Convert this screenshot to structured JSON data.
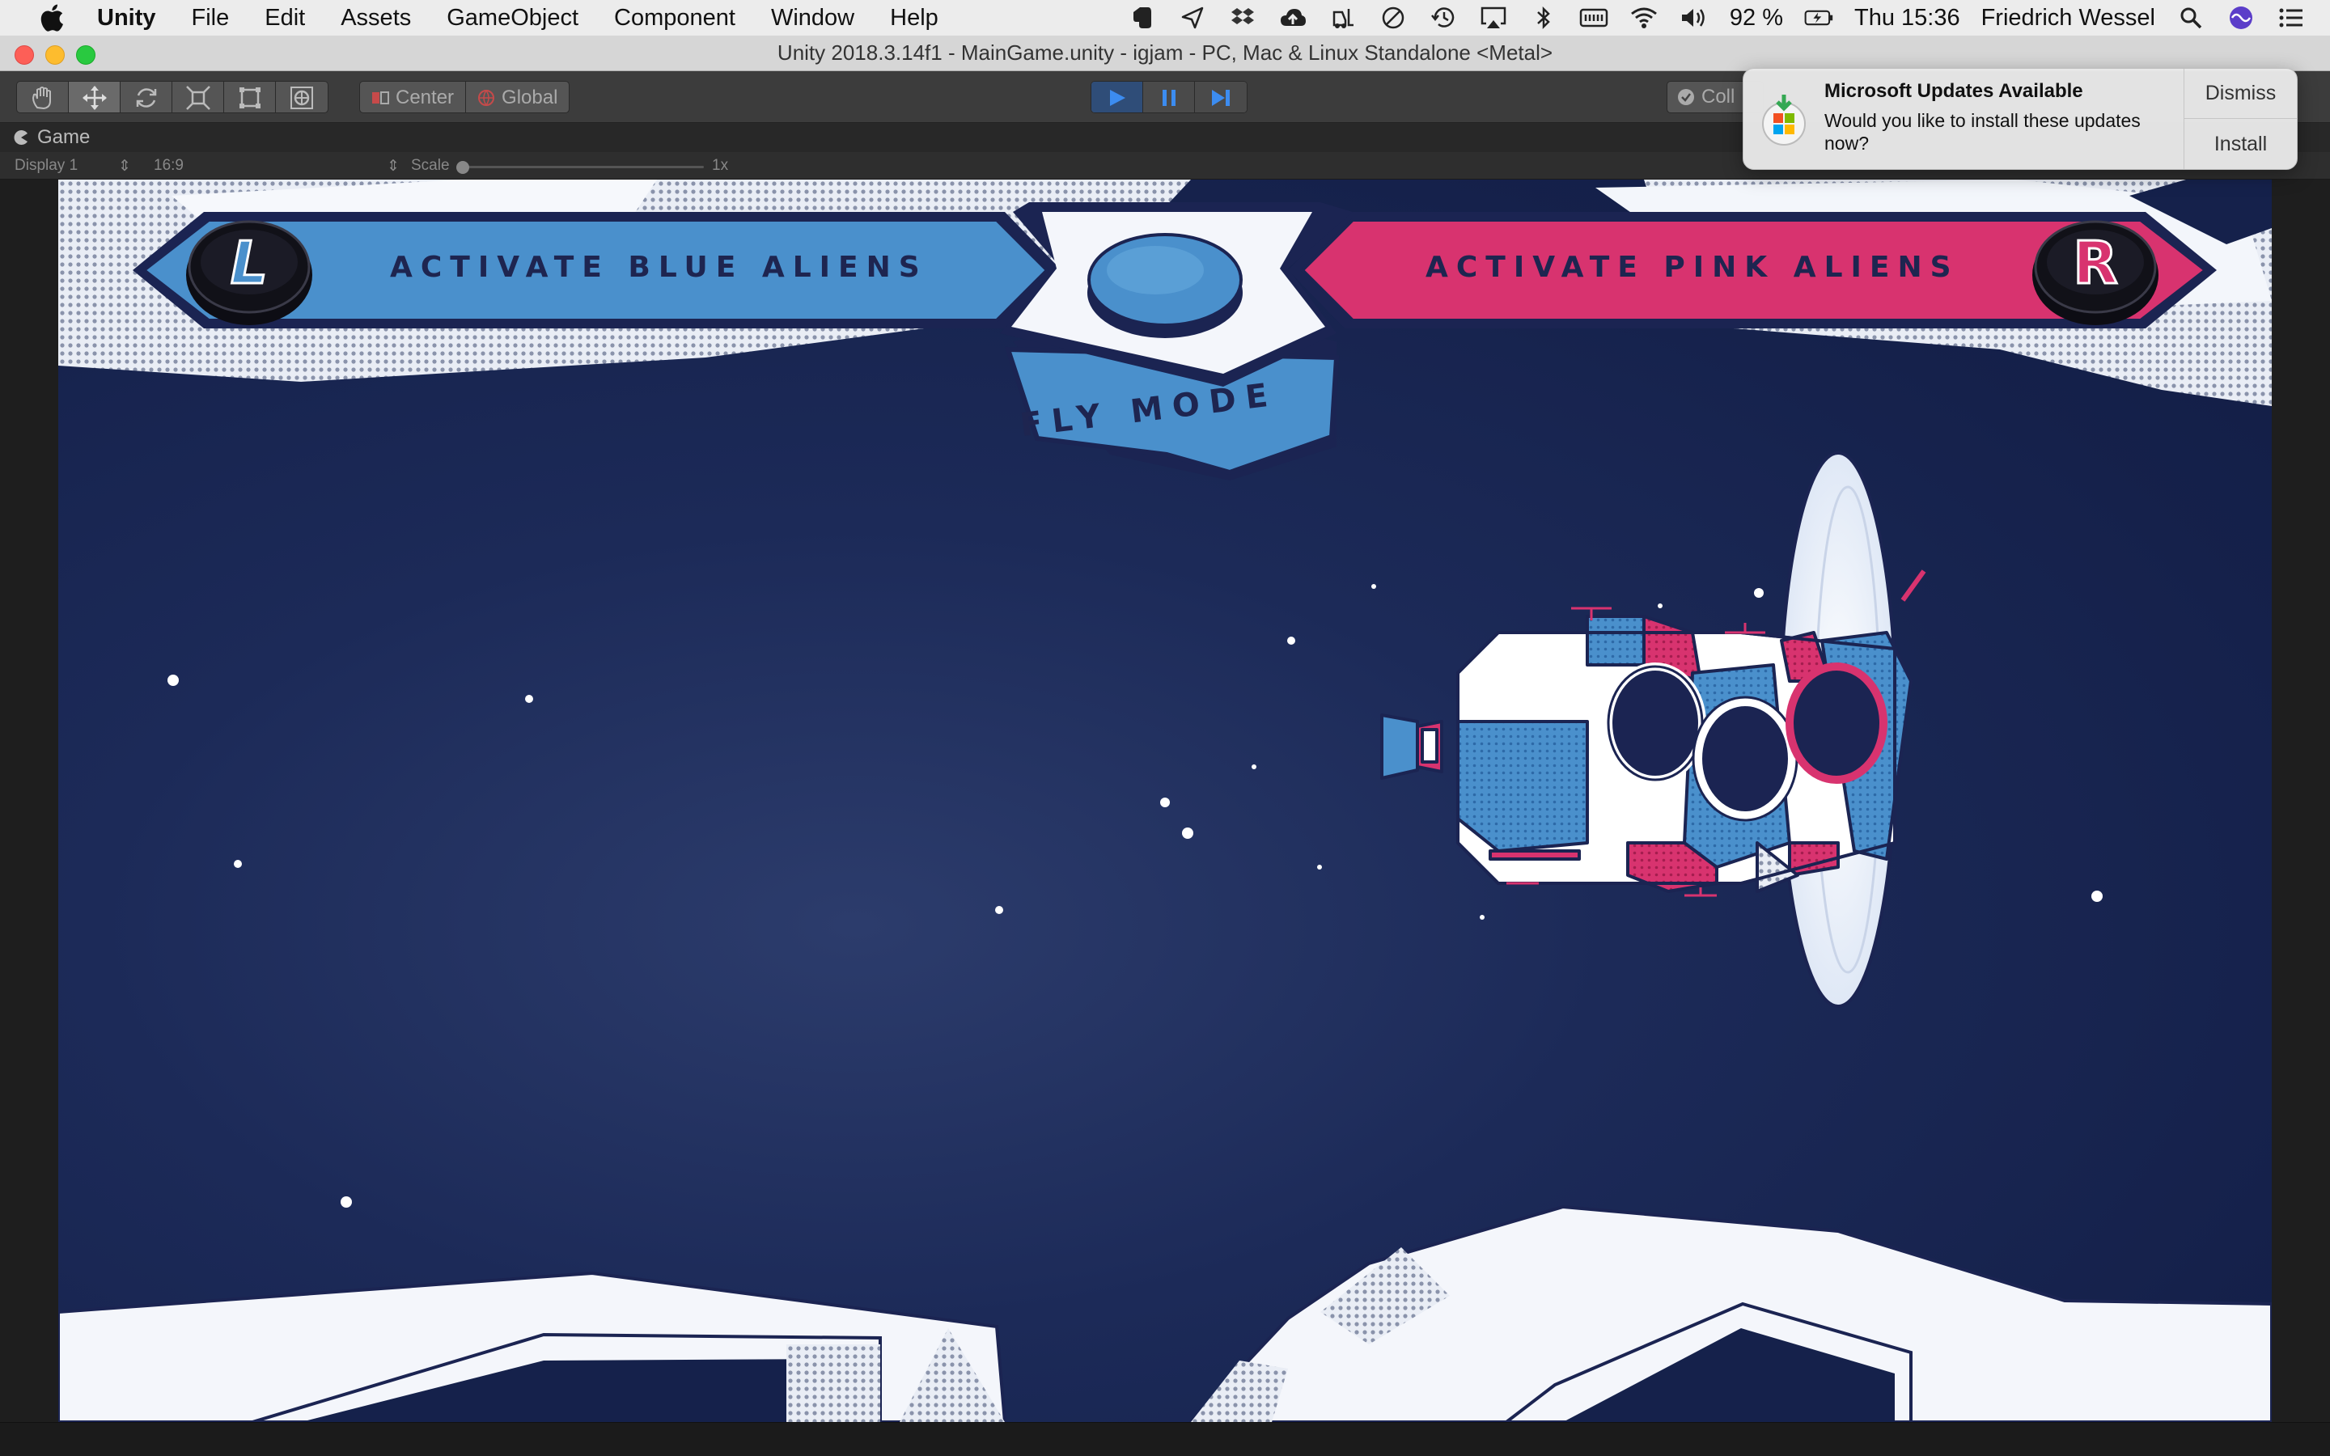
{
  "menubar": {
    "app_name": "Unity",
    "items": [
      "File",
      "Edit",
      "Assets",
      "GameObject",
      "Component",
      "Window",
      "Help"
    ],
    "battery": "92 %",
    "clock": "Thu 15:36",
    "user": "Friedrich Wessel",
    "status_icons": [
      "evernote-icon",
      "send-icon",
      "dropbox-icon",
      "cloud-upload-icon",
      "forklift-icon",
      "do-not-disturb-icon",
      "time-machine-icon",
      "airplay-icon",
      "bluetooth-icon",
      "keyboard-icon",
      "wifi-icon",
      "volume-icon",
      "battery-icon",
      "spotlight-icon",
      "siri-icon",
      "notification-center-icon"
    ]
  },
  "window": {
    "title": "Unity 2018.3.14f1 - MainGame.unity - igjam - PC, Mac & Linux Standalone <Metal>"
  },
  "toolbar": {
    "tools": [
      "hand-tool-icon",
      "move-tool-icon",
      "rotate-tool-icon",
      "scale-tool-icon",
      "rect-tool-icon",
      "transform-tool-icon"
    ],
    "active_tool": "move-tool-icon",
    "pivot_label": "Center",
    "space_label": "Global",
    "collab_label": "Coll",
    "play_state": "playing"
  },
  "game_view": {
    "tab_label": "Game",
    "display": "Display 1",
    "aspect": "16:9",
    "scale_label": "Scale",
    "scale_value": "1x",
    "scale_fraction": 0.0
  },
  "hud": {
    "left_button_letter": "L",
    "left_label": "Activate Blue Aliens",
    "right_button_letter": "R",
    "right_label": "Activate Pink Aliens",
    "mode_label": "Fly Mode",
    "colors": {
      "blue": "#4a90cc",
      "pink": "#d8336f",
      "navy": "#1b2452",
      "space": "#1c2a58",
      "white": "#f4f6fb"
    }
  },
  "notification": {
    "title": "Microsoft Updates Available",
    "body": "Would you like to install these updates now?",
    "dismiss_label": "Dismiss",
    "install_label": "Install"
  }
}
